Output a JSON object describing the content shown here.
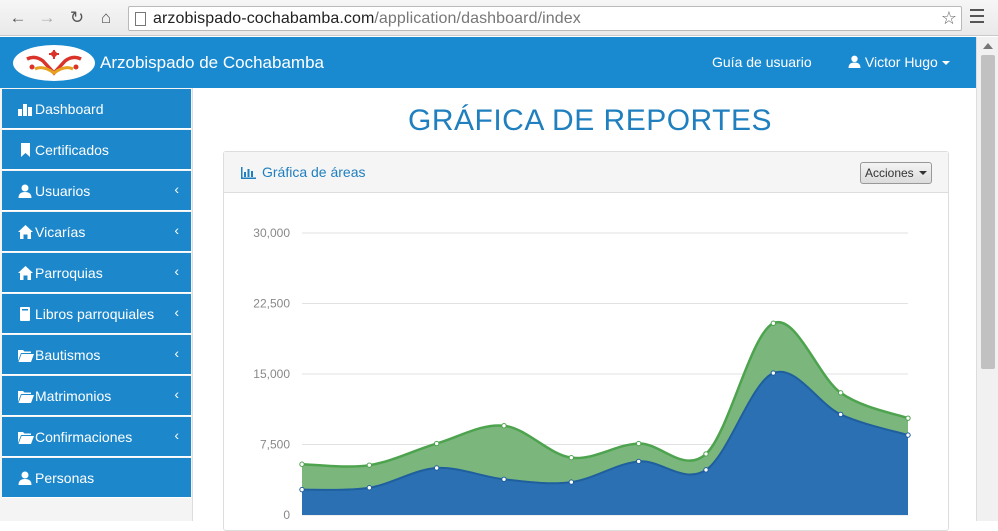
{
  "browser": {
    "url_host": "arzobispado-cochabamba.com",
    "url_path": "/application/dashboard/index",
    "icons": [
      "back-icon",
      "forward-icon",
      "reload-icon",
      "home-icon",
      "star-icon",
      "menu-icon"
    ]
  },
  "navbar": {
    "brand": "Arzobispado de Cochabamba",
    "guide_link": "Guía de usuario",
    "user_menu": "Victor Hugo",
    "color": "#1a8ad0"
  },
  "sidebar": {
    "items": [
      {
        "label": "Dashboard",
        "icon": "bar-chart-icon",
        "has_submenu": false
      },
      {
        "label": "Certificados",
        "icon": "bookmark-icon",
        "has_submenu": false
      },
      {
        "label": "Usuarios",
        "icon": "user-icon",
        "has_submenu": true
      },
      {
        "label": "Vicarías",
        "icon": "home-icon",
        "has_submenu": true
      },
      {
        "label": "Parroquias",
        "icon": "home-icon",
        "has_submenu": true
      },
      {
        "label": "Libros parroquiales",
        "icon": "book-icon",
        "has_submenu": true
      },
      {
        "label": "Bautismos",
        "icon": "folder-open-icon",
        "has_submenu": true
      },
      {
        "label": "Matrimonios",
        "icon": "folder-open-icon",
        "has_submenu": true
      },
      {
        "label": "Confirmaciones",
        "icon": "folder-open-icon",
        "has_submenu": true
      },
      {
        "label": "Personas",
        "icon": "user-icon",
        "has_submenu": false
      }
    ],
    "item_color": "#1c87cb"
  },
  "main": {
    "title": "GRÁFICA DE REPORTES",
    "panel_title": "Gráfica de áreas",
    "actions_button": "Acciones"
  },
  "chart_data": {
    "type": "area",
    "title": "",
    "xlabel": "",
    "ylabel": "",
    "ylim": [
      0,
      30000
    ],
    "y_ticks": [
      "30,000",
      "22,500",
      "15,000",
      "7,500",
      "0"
    ],
    "y_tick_values": [
      30000,
      22500,
      15000,
      7500,
      0
    ],
    "grid": true,
    "stacked": true,
    "x": [
      1,
      2,
      3,
      4,
      5,
      6,
      7,
      8,
      9,
      10
    ],
    "series": [
      {
        "values": [
          2700,
          2900,
          5000,
          3800,
          3500,
          5700,
          4800,
          15100,
          10700,
          8500
        ],
        "color": "#2b70b3"
      },
      {
        "values": [
          2700,
          2400,
          2600,
          5700,
          2600,
          1900,
          1700,
          5300,
          2300,
          1800
        ],
        "color": "#7bb77d"
      }
    ],
    "line_color_top": "#4ea34f",
    "line_color_bottom": "#1f5f9e"
  }
}
